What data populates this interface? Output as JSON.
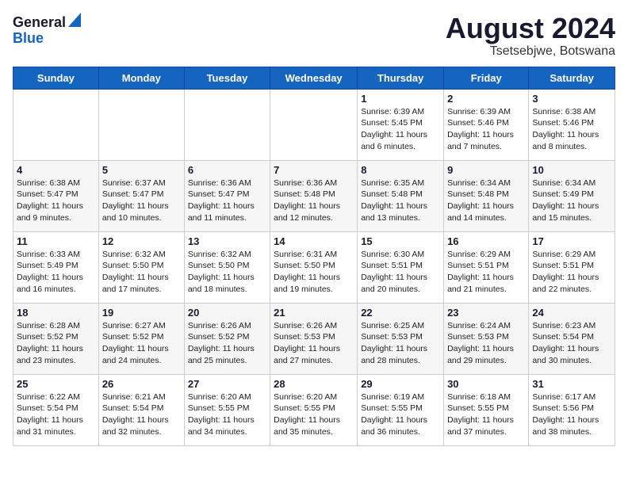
{
  "logo": {
    "general": "General",
    "blue": "Blue"
  },
  "title": {
    "month_year": "August 2024",
    "location": "Tsetsebjwe, Botswana"
  },
  "headers": [
    "Sunday",
    "Monday",
    "Tuesday",
    "Wednesday",
    "Thursday",
    "Friday",
    "Saturday"
  ],
  "weeks": [
    [
      {
        "day": "",
        "info": ""
      },
      {
        "day": "",
        "info": ""
      },
      {
        "day": "",
        "info": ""
      },
      {
        "day": "",
        "info": ""
      },
      {
        "day": "1",
        "info": "Sunrise: 6:39 AM\nSunset: 5:45 PM\nDaylight: 11 hours\nand 6 minutes."
      },
      {
        "day": "2",
        "info": "Sunrise: 6:39 AM\nSunset: 5:46 PM\nDaylight: 11 hours\nand 7 minutes."
      },
      {
        "day": "3",
        "info": "Sunrise: 6:38 AM\nSunset: 5:46 PM\nDaylight: 11 hours\nand 8 minutes."
      }
    ],
    [
      {
        "day": "4",
        "info": "Sunrise: 6:38 AM\nSunset: 5:47 PM\nDaylight: 11 hours\nand 9 minutes."
      },
      {
        "day": "5",
        "info": "Sunrise: 6:37 AM\nSunset: 5:47 PM\nDaylight: 11 hours\nand 10 minutes."
      },
      {
        "day": "6",
        "info": "Sunrise: 6:36 AM\nSunset: 5:47 PM\nDaylight: 11 hours\nand 11 minutes."
      },
      {
        "day": "7",
        "info": "Sunrise: 6:36 AM\nSunset: 5:48 PM\nDaylight: 11 hours\nand 12 minutes."
      },
      {
        "day": "8",
        "info": "Sunrise: 6:35 AM\nSunset: 5:48 PM\nDaylight: 11 hours\nand 13 minutes."
      },
      {
        "day": "9",
        "info": "Sunrise: 6:34 AM\nSunset: 5:48 PM\nDaylight: 11 hours\nand 14 minutes."
      },
      {
        "day": "10",
        "info": "Sunrise: 6:34 AM\nSunset: 5:49 PM\nDaylight: 11 hours\nand 15 minutes."
      }
    ],
    [
      {
        "day": "11",
        "info": "Sunrise: 6:33 AM\nSunset: 5:49 PM\nDaylight: 11 hours\nand 16 minutes."
      },
      {
        "day": "12",
        "info": "Sunrise: 6:32 AM\nSunset: 5:50 PM\nDaylight: 11 hours\nand 17 minutes."
      },
      {
        "day": "13",
        "info": "Sunrise: 6:32 AM\nSunset: 5:50 PM\nDaylight: 11 hours\nand 18 minutes."
      },
      {
        "day": "14",
        "info": "Sunrise: 6:31 AM\nSunset: 5:50 PM\nDaylight: 11 hours\nand 19 minutes."
      },
      {
        "day": "15",
        "info": "Sunrise: 6:30 AM\nSunset: 5:51 PM\nDaylight: 11 hours\nand 20 minutes."
      },
      {
        "day": "16",
        "info": "Sunrise: 6:29 AM\nSunset: 5:51 PM\nDaylight: 11 hours\nand 21 minutes."
      },
      {
        "day": "17",
        "info": "Sunrise: 6:29 AM\nSunset: 5:51 PM\nDaylight: 11 hours\nand 22 minutes."
      }
    ],
    [
      {
        "day": "18",
        "info": "Sunrise: 6:28 AM\nSunset: 5:52 PM\nDaylight: 11 hours\nand 23 minutes."
      },
      {
        "day": "19",
        "info": "Sunrise: 6:27 AM\nSunset: 5:52 PM\nDaylight: 11 hours\nand 24 minutes."
      },
      {
        "day": "20",
        "info": "Sunrise: 6:26 AM\nSunset: 5:52 PM\nDaylight: 11 hours\nand 25 minutes."
      },
      {
        "day": "21",
        "info": "Sunrise: 6:26 AM\nSunset: 5:53 PM\nDaylight: 11 hours\nand 27 minutes."
      },
      {
        "day": "22",
        "info": "Sunrise: 6:25 AM\nSunset: 5:53 PM\nDaylight: 11 hours\nand 28 minutes."
      },
      {
        "day": "23",
        "info": "Sunrise: 6:24 AM\nSunset: 5:53 PM\nDaylight: 11 hours\nand 29 minutes."
      },
      {
        "day": "24",
        "info": "Sunrise: 6:23 AM\nSunset: 5:54 PM\nDaylight: 11 hours\nand 30 minutes."
      }
    ],
    [
      {
        "day": "25",
        "info": "Sunrise: 6:22 AM\nSunset: 5:54 PM\nDaylight: 11 hours\nand 31 minutes."
      },
      {
        "day": "26",
        "info": "Sunrise: 6:21 AM\nSunset: 5:54 PM\nDaylight: 11 hours\nand 32 minutes."
      },
      {
        "day": "27",
        "info": "Sunrise: 6:20 AM\nSunset: 5:55 PM\nDaylight: 11 hours\nand 34 minutes."
      },
      {
        "day": "28",
        "info": "Sunrise: 6:20 AM\nSunset: 5:55 PM\nDaylight: 11 hours\nand 35 minutes."
      },
      {
        "day": "29",
        "info": "Sunrise: 6:19 AM\nSunset: 5:55 PM\nDaylight: 11 hours\nand 36 minutes."
      },
      {
        "day": "30",
        "info": "Sunrise: 6:18 AM\nSunset: 5:55 PM\nDaylight: 11 hours\nand 37 minutes."
      },
      {
        "day": "31",
        "info": "Sunrise: 6:17 AM\nSunset: 5:56 PM\nDaylight: 11 hours\nand 38 minutes."
      }
    ]
  ]
}
